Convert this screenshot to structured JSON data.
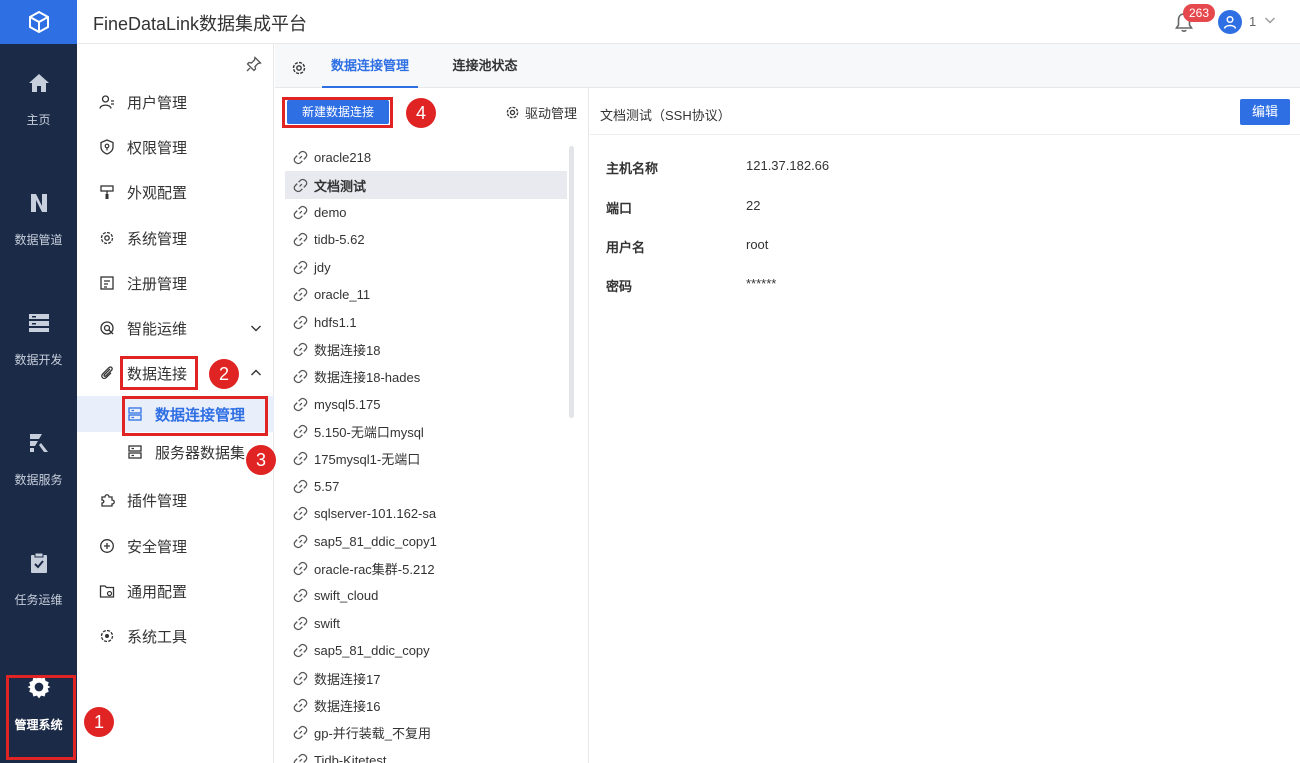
{
  "app": {
    "title": "FineDataLink数据集成平台"
  },
  "header": {
    "notification_count": "263",
    "user_name": "1"
  },
  "rail": {
    "items": [
      {
        "label": "主页",
        "icon": "home-icon"
      },
      {
        "label": "数据管道",
        "icon": "pipeline-icon"
      },
      {
        "label": "数据开发",
        "icon": "dev-icon"
      },
      {
        "label": "数据服务",
        "icon": "service-icon"
      },
      {
        "label": "任务运维",
        "icon": "task-icon"
      },
      {
        "label": "管理系统",
        "icon": "gear-icon"
      }
    ]
  },
  "sidebar": {
    "items": [
      {
        "label": "用户管理"
      },
      {
        "label": "权限管理"
      },
      {
        "label": "外观配置"
      },
      {
        "label": "系统管理"
      },
      {
        "label": "注册管理"
      },
      {
        "label": "智能运维"
      },
      {
        "label": "数据连接"
      },
      {
        "label": "数据连接管理"
      },
      {
        "label": "服务器数据集"
      },
      {
        "label": "插件管理"
      },
      {
        "label": "安全管理"
      },
      {
        "label": "通用配置"
      },
      {
        "label": "系统工具"
      }
    ]
  },
  "markers": [
    "1",
    "2",
    "3",
    "4"
  ],
  "tabs": [
    {
      "label": "数据连接管理"
    },
    {
      "label": "连接池状态"
    }
  ],
  "list": {
    "new_button": "新建数据连接",
    "driver_label": "驱动管理",
    "connections": [
      "oracle218",
      "文档测试",
      "demo",
      "tidb-5.62",
      "jdy",
      "oracle_11",
      "hdfs1.1",
      "数据连接18",
      "数据连接18-hades",
      "mysql5.175",
      "5.150-无端口mysql",
      "175mysql1-无端口",
      "5.57",
      "sqlserver-101.162-sa",
      "sap5_81_ddic_copy1",
      "oracle-rac集群-5.212",
      "swift_cloud",
      "swift",
      "sap5_81_ddic_copy",
      "数据连接17",
      "数据连接16",
      "gp-并行装载_不复用",
      "Tidb-Kitetest"
    ]
  },
  "detail": {
    "title": "文档测试（SSH协议）",
    "edit_button": "编辑",
    "fields": [
      {
        "label": "主机名称",
        "value": "121.37.182.66"
      },
      {
        "label": "端口",
        "value": "22"
      },
      {
        "label": "用户名",
        "value": "root"
      },
      {
        "label": "密码",
        "value": "******"
      }
    ]
  },
  "colors": {
    "primary": "#2f6fe4",
    "rail": "#1b2a47",
    "highlight": "#e02424"
  }
}
